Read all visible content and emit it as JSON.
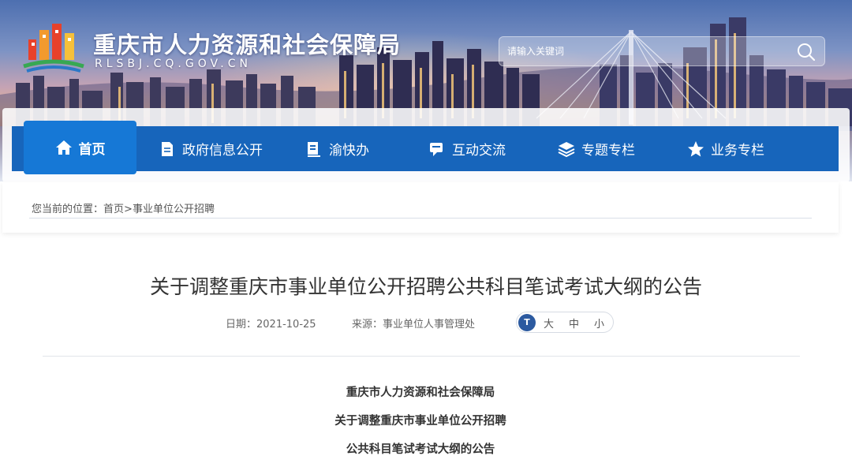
{
  "header": {
    "site_title": "重庆市人力资源和社会保障局",
    "site_domain": "RLSBJ.CQ.GOV.CN",
    "search": {
      "placeholder": "请输入关键词"
    }
  },
  "nav": {
    "items": [
      {
        "label": "首页",
        "icon": "home-icon",
        "active": true
      },
      {
        "label": "政府信息公开",
        "icon": "document-icon"
      },
      {
        "label": "渝快办",
        "icon": "form-icon"
      },
      {
        "label": "互动交流",
        "icon": "chat-icon"
      },
      {
        "label": "专题专栏",
        "icon": "layers-icon"
      },
      {
        "label": "业务专栏",
        "icon": "star-icon"
      }
    ]
  },
  "breadcrumb": {
    "prefix": "您当前的位置：",
    "home": "首页",
    "separator": ">",
    "current": "事业单位公开招聘"
  },
  "article": {
    "title": "关于调整重庆市事业单位公开招聘公共科目笔试考试大纲的公告",
    "date_label": "日期：2021-10-25",
    "source_label": "来源：事业单位人事管理处",
    "font_size_icon_text": "T",
    "font_sizes": [
      "大",
      "中",
      "小"
    ],
    "body_lines": [
      "重庆市人力资源和社会保障局",
      "关于调整重庆市事业单位公开招聘",
      "公共科目笔试考试大纲的公告"
    ]
  },
  "colors": {
    "nav_bg": "#1765bb",
    "nav_active": "#1678d6",
    "title_text": "#333333"
  }
}
